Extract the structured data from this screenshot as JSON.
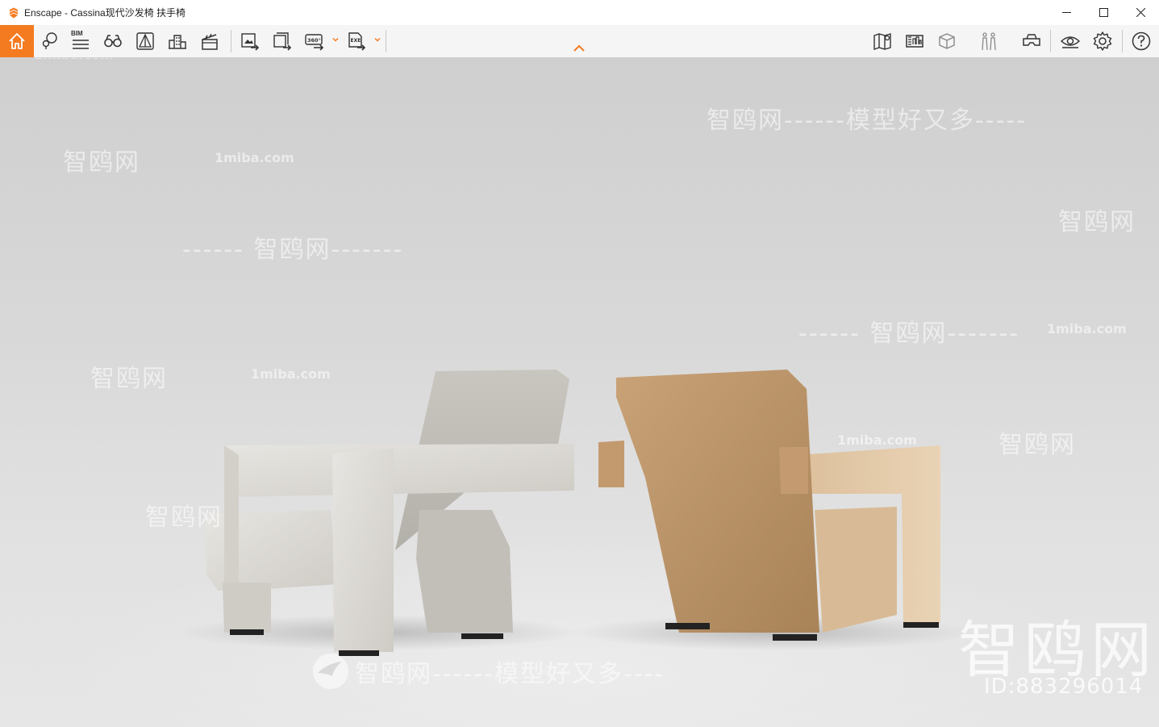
{
  "window": {
    "title": "Enscape - Cassina现代沙发椅 扶手椅",
    "accent_color": "#f47b20",
    "controls": [
      "minimize-icon",
      "maximize-icon",
      "close-icon"
    ]
  },
  "toolbar": {
    "left_icons": [
      "home-icon",
      "map-location-icon",
      "bim-icon",
      "binoculars-icon",
      "sketch-icon",
      "buildings-icon",
      "clapperboard-icon",
      "export-image-icon",
      "batch-render-icon",
      "panorama-360-icon",
      "export-exe-icon"
    ],
    "bim_label": "BIM",
    "right_icons": [
      "map-view-icon",
      "info-panel-icon",
      "cube-view-icon",
      "people-icon",
      "vr-headset-icon",
      "eye-view-icon",
      "settings-gear-icon",
      "help-icon"
    ],
    "collapse_icon": "chevron-up-icon"
  },
  "watermarks": {
    "site": "1miba.com",
    "brand": "智鸥网",
    "slogan": "智鸥网------模型好又多----",
    "slogan_top": "智鸥网------模型好又多-----",
    "line_brand": "------ 智鸥网-------",
    "big_brand": "智鸥网",
    "id_text": "ID:883296014"
  }
}
